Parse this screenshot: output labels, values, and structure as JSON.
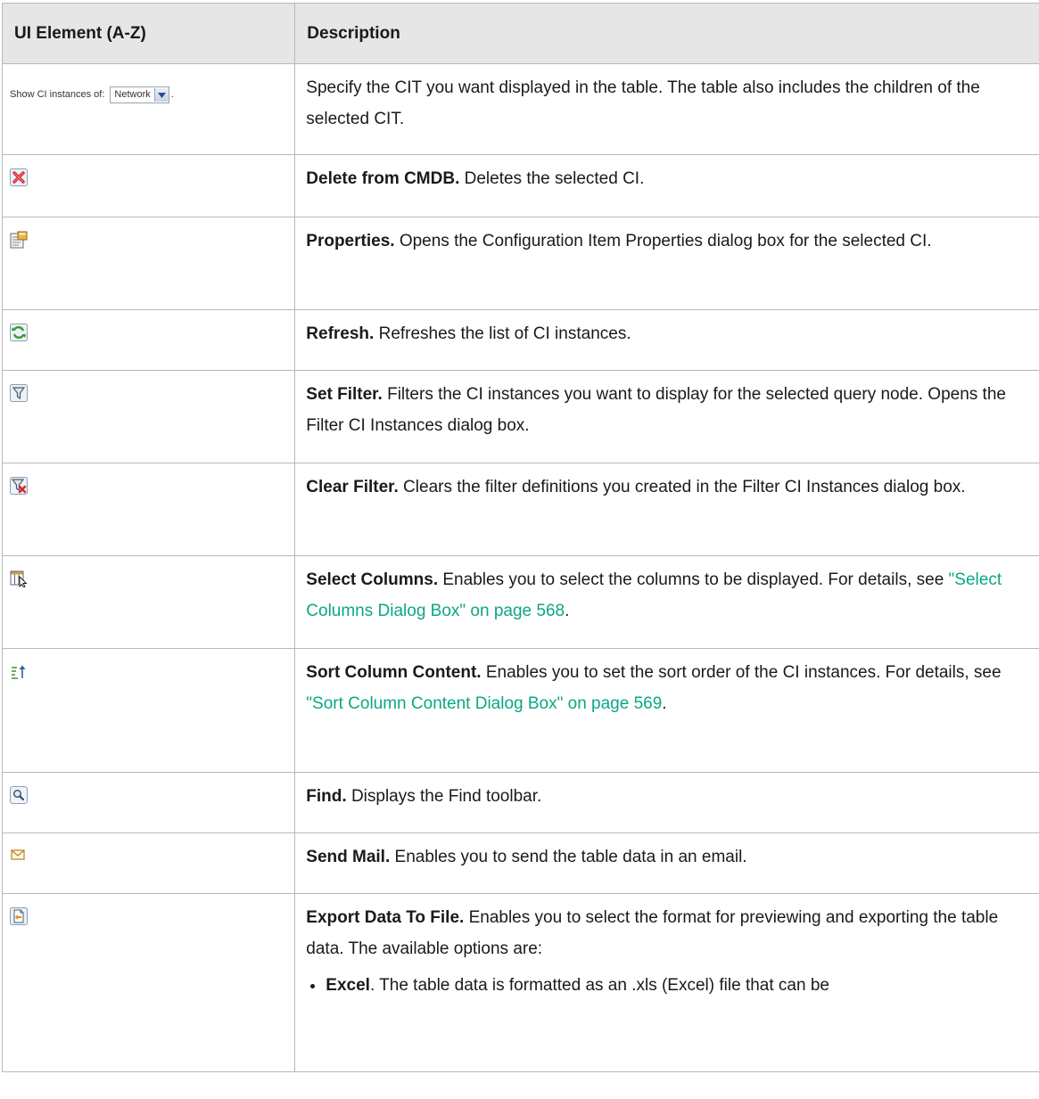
{
  "header": {
    "col1": "UI Element (A-Z)",
    "col2": "Description"
  },
  "showci": {
    "label": "Show CI instances of:",
    "value": "Network",
    "trailing": "."
  },
  "rows": {
    "r0": {
      "text": "Specify the CIT you want displayed in the table. The table also includes the children of the selected CIT."
    },
    "r1": {
      "icon": "delete-icon",
      "bold": "Delete from CMDB.",
      "text": " Deletes the selected CI."
    },
    "r2": {
      "icon": "properties-icon",
      "bold": "Properties.",
      "text": " Opens the Configuration Item Properties dialog box for the selected CI."
    },
    "r3": {
      "icon": "refresh-icon",
      "bold": "Refresh.",
      "text": " Refreshes the list of CI instances."
    },
    "r4": {
      "icon": "filter-icon",
      "bold": "Set Filter.",
      "text": " Filters the CI instances you want to display for the selected query node. Opens the Filter CI Instances dialog box."
    },
    "r5": {
      "icon": "clear-filter-icon",
      "bold": "Clear Filter.",
      "text": " Clears the filter definitions you created in the Filter CI Instances dialog box."
    },
    "r6": {
      "icon": "select-columns-icon",
      "bold": "Select Columns.",
      "text": " Enables you to select the columns to be displayed. For details, see ",
      "link": "\"Select Columns Dialog Box\" on page 568",
      "end": "."
    },
    "r7": {
      "icon": "sort-icon",
      "bold": "Sort Column Content.",
      "text": " Enables you to set the sort order of the CI instances. For details, see ",
      "link": "\"Sort Column Content Dialog Box\" on page 569",
      "end": "."
    },
    "r8": {
      "icon": "find-icon",
      "bold": "Find.",
      "text": " Displays the Find toolbar."
    },
    "r9": {
      "icon": "mail-icon",
      "bold": "Send Mail.",
      "text": " Enables you to send the table data in an email."
    },
    "r10": {
      "icon": "export-icon",
      "bold": "Export Data To File.",
      "text": " Enables you to select the format for previewing and exporting the table data. The available options are:",
      "option_bold": "Excel",
      "option_text": ". The table data is formatted as an .xls (Excel) file that can be"
    }
  },
  "colors": {
    "link": "#0aa883",
    "header_bg": "#e6e6e6",
    "border": "#b8b8b8"
  }
}
